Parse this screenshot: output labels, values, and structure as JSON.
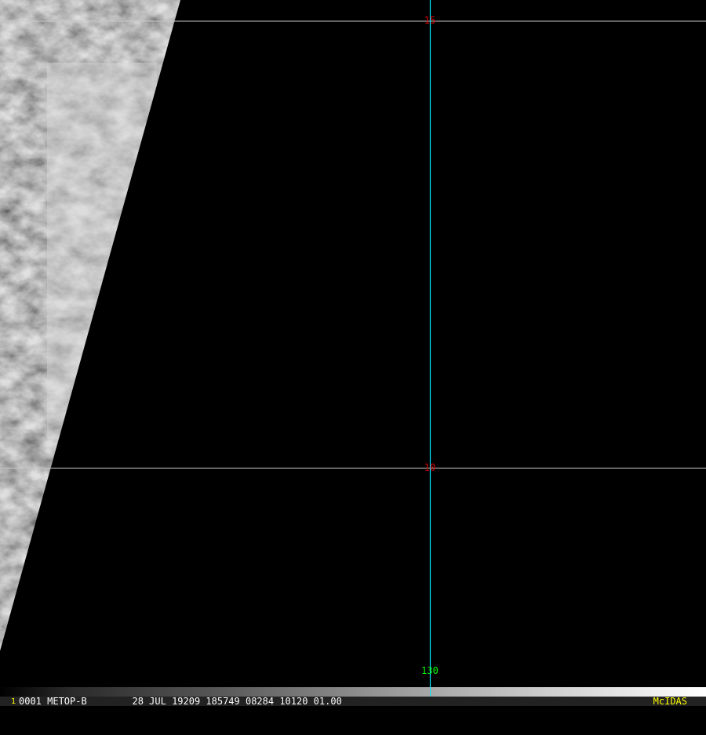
{
  "image": {
    "satellite": "METOP-B",
    "frame_number": "1",
    "status_line": "0001 METOP-B        28 JUL 19209 185749 08284 10120 01.00",
    "software": "McIDAS"
  },
  "grid": {
    "latitude_labels": [
      "15",
      "10"
    ],
    "longitude_labels": [
      "130"
    ],
    "colors": {
      "lat_line": "#c8c8c8",
      "lon_line": "#00e5ff",
      "lat_text": "#e00000",
      "lon_text": "#00ff00"
    }
  }
}
